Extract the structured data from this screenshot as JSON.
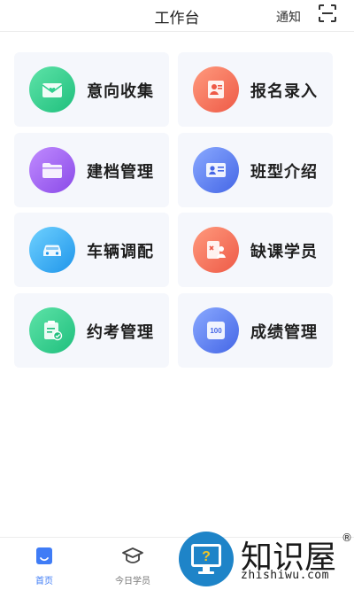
{
  "header": {
    "title": "工作台",
    "notify_label": "通知",
    "scan_icon": "scan-icon"
  },
  "cards": [
    {
      "label": "意向收集",
      "icon": "envelope-heart-icon",
      "color": "#2fcf8e"
    },
    {
      "label": "报名录入",
      "icon": "profile-card-icon",
      "color": "#f3705a"
    },
    {
      "label": "建档管理",
      "icon": "folder-icon",
      "color": "#9b5cf0"
    },
    {
      "label": "班型介绍",
      "icon": "id-card-icon",
      "color": "#4f77ef"
    },
    {
      "label": "车辆调配",
      "icon": "car-icon",
      "color": "#33aaf0"
    },
    {
      "label": "缺课学员",
      "icon": "student-absent-icon",
      "color": "#f26c56"
    },
    {
      "label": "约考管理",
      "icon": "clipboard-check-icon",
      "color": "#2fcf8e"
    },
    {
      "label": "成绩管理",
      "icon": "score-100-icon",
      "color": "#4f77ef"
    }
  ],
  "bottom_nav": [
    {
      "label": "首页",
      "icon": "home-icon",
      "active": true
    },
    {
      "label": "今日学员",
      "icon": "graduation-cap-icon",
      "active": false
    }
  ],
  "watermark": {
    "brand": "知识屋",
    "domain": "zhishiwu.com",
    "registered": "®"
  },
  "colors": {
    "accent": "#3f7cf6",
    "card_bg": "#f5f7fc",
    "watermark_blue": "#1e84c8"
  }
}
